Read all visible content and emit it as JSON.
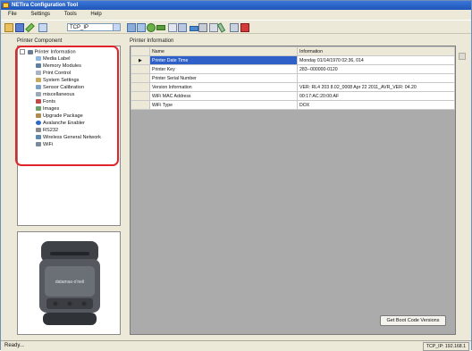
{
  "app": {
    "title": "NETira Configuration Tool"
  },
  "menu": {
    "items": [
      "File",
      "Settings",
      "Tools",
      "Help"
    ]
  },
  "toolbar": {
    "combo_value": "TCP_IP"
  },
  "left": {
    "label": "Printer Component",
    "tree": [
      {
        "label": "Printer Information",
        "icon": "printer-icon",
        "level": 0
      },
      {
        "label": "Media Label",
        "icon": "label-icon",
        "level": 1
      },
      {
        "label": "Memory Modules",
        "icon": "memory-icon",
        "level": 1
      },
      {
        "label": "Print Control",
        "icon": "print-icon",
        "level": 1
      },
      {
        "label": "System Settings",
        "icon": "settings-icon",
        "level": 1
      },
      {
        "label": "Sensor Calibration",
        "icon": "sensor-icon",
        "level": 1
      },
      {
        "label": "miscellaneous",
        "icon": "misc-icon",
        "level": 1
      },
      {
        "label": "Fonts",
        "icon": "font-icon",
        "level": 1
      },
      {
        "label": "Images",
        "icon": "image-icon",
        "level": 1
      },
      {
        "label": "Upgrade Package",
        "icon": "package-icon",
        "level": 1
      },
      {
        "label": "Avalanche Enabler",
        "icon": "avalanche-icon",
        "level": 1
      },
      {
        "label": "RS232",
        "icon": "serial-icon",
        "level": 1
      },
      {
        "label": "Wireless General Network",
        "icon": "network-icon",
        "level": 1
      },
      {
        "label": "WiFi",
        "icon": "wifi-icon",
        "level": 1
      }
    ],
    "printer_brand": "datamax-o'neil"
  },
  "right": {
    "label": "Printer Information",
    "columns": [
      "Name",
      "Information"
    ],
    "rows": [
      {
        "name": "Printer Date Time",
        "info": "Monday 01/14/1970 02:36, 014",
        "selected": true
      },
      {
        "name": "Printer Key",
        "info": "283--000000-0120",
        "selected": false
      },
      {
        "name": "Printer Serial Number",
        "info": "",
        "selected": false
      },
      {
        "name": "Version Information",
        "info": "VER: RL4 203 8.02_0008 Apr 22 2011_AVR_VER: 04.20",
        "selected": false
      },
      {
        "name": "WiFi MAC Address",
        "info": "00:17:AC:20:00:AF",
        "selected": false
      },
      {
        "name": "WiFi Type",
        "info": "DOX",
        "selected": false
      }
    ],
    "get_boot_button": "Get Boot Code Versions"
  },
  "status": {
    "left": "Ready...",
    "right": "TCP_IP: 192.168.1"
  },
  "colors": {
    "highlight": "#e0242a",
    "selection": "#2f60c8",
    "title_bar": "#2a62c8"
  }
}
